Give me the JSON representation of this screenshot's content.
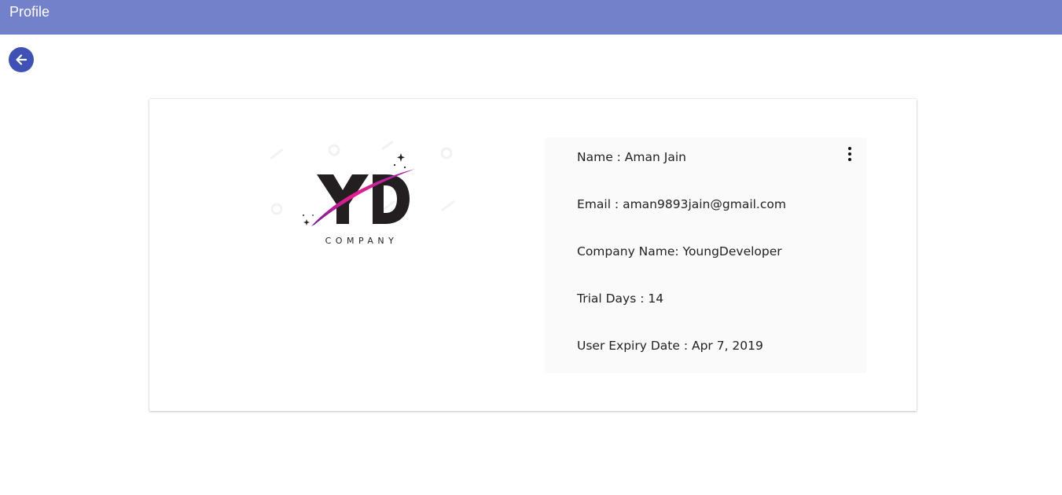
{
  "header": {
    "title": "Profile"
  },
  "icons": {
    "back": "arrow-left-icon",
    "menu": "more-vertical-icon"
  },
  "colors": {
    "topbar": "#7380ca",
    "back_button": "#3f51b5",
    "panel_background": "#fafafa"
  },
  "logo": {
    "monogram": "YD",
    "caption": "COMPANY"
  },
  "profile": {
    "name": "Name : Aman Jain",
    "email": "Email : aman9893jain@gmail.com",
    "company": "Company Name: YoungDeveloper",
    "trial_days": "Trial Days : 14",
    "expiry": "User Expiry Date : Apr 7, 2019"
  }
}
